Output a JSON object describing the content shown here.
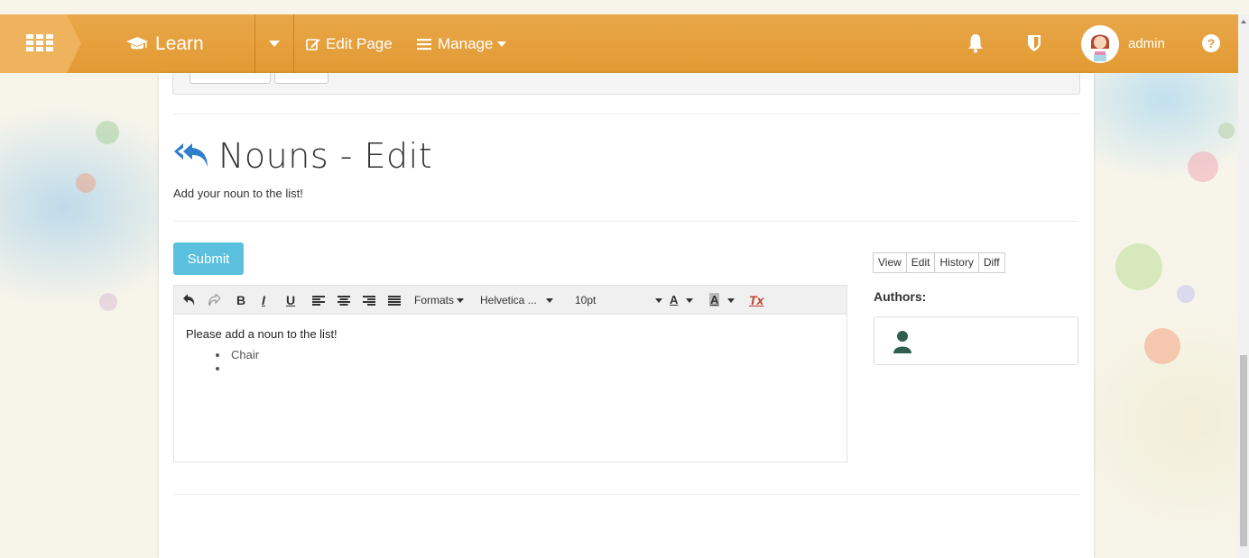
{
  "nav": {
    "learn_label": "Learn",
    "edit_page_label": "Edit Page",
    "manage_label": "Manage",
    "admin_label": "admin",
    "help_glyph": "?",
    "colors": {
      "bar": "#e29a33",
      "accent": "#5bc0de"
    }
  },
  "page": {
    "title": "Nouns - Edit",
    "subtitle": "Add your noun to the list!",
    "submit_label": "Submit"
  },
  "editor": {
    "toolbar": {
      "bold": "B",
      "italic": "I",
      "underline": "U",
      "formats_label": "Formats",
      "font_family": "Helvetica ...",
      "font_size": "10pt",
      "text_color_glyph": "A",
      "bg_color_glyph": "A",
      "clear_format_glyph": "Tx"
    },
    "content": {
      "intro": "Please add a noun to the list!",
      "items": [
        "Chair",
        ""
      ]
    }
  },
  "sidebar": {
    "tabs": [
      "View",
      "Edit",
      "History",
      "Diff"
    ],
    "authors_label": "Authors:"
  },
  "icons": [
    "apps-grid-icon",
    "graduation-cap-icon",
    "edit-icon",
    "hamburger-icon",
    "bell-icon",
    "shield-icon",
    "help-icon",
    "reply-all-icon",
    "undo-icon",
    "redo-icon",
    "align-left-icon",
    "align-center-icon",
    "align-right-icon",
    "align-justify-icon",
    "user-icon"
  ]
}
